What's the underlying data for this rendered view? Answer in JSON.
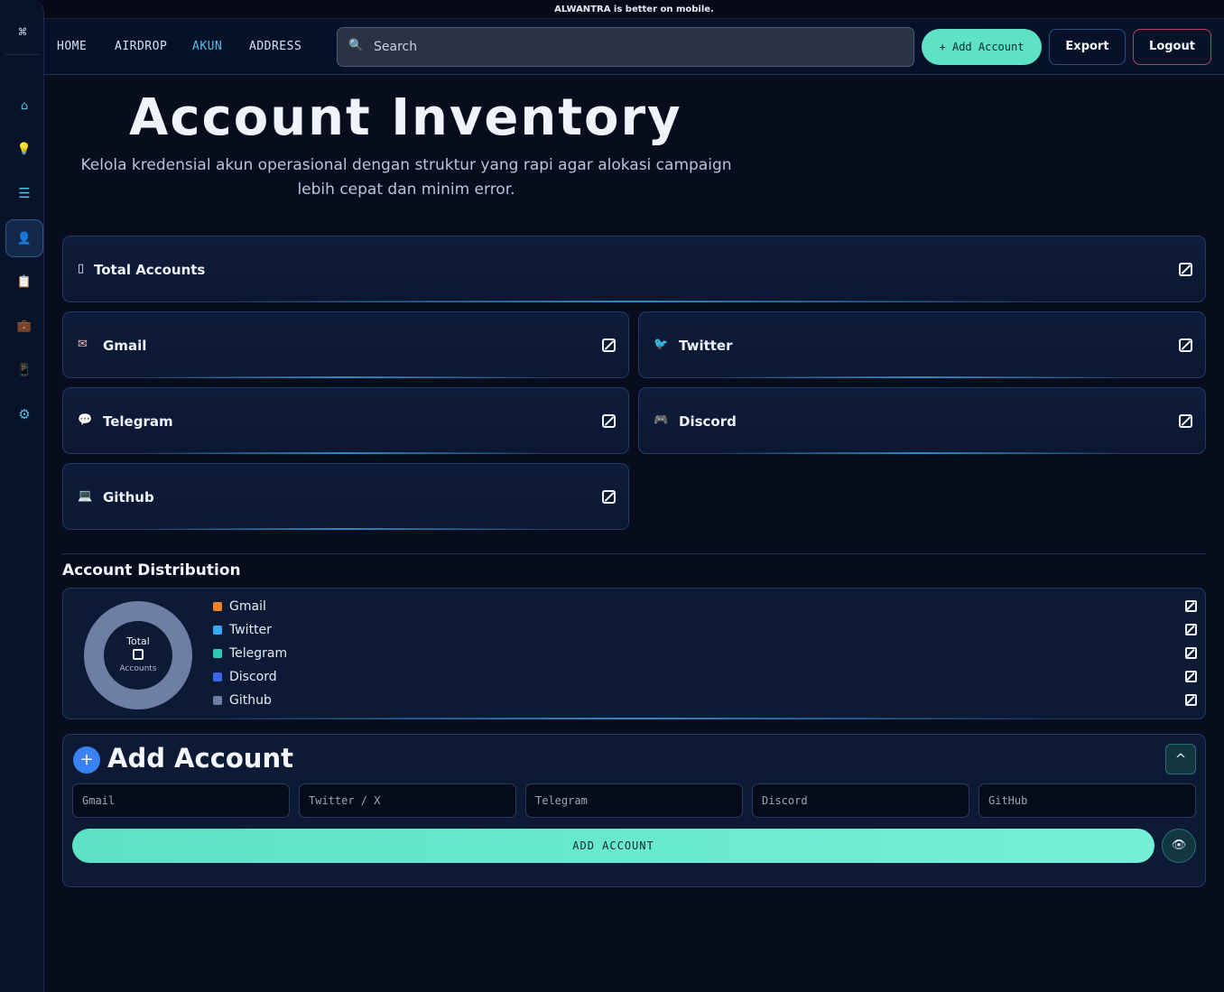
{
  "banner": "ALWANTRA is better on mobile.",
  "sidebar": {
    "logo": "⌘",
    "items": [
      {
        "icon": "home-icon",
        "glyph": "⌂",
        "color": "#4cc4e8"
      },
      {
        "icon": "lightbulb-icon",
        "glyph": "💡",
        "color": "#f5c542"
      },
      {
        "icon": "list-icon",
        "glyph": "☰",
        "color": "#4cc4e8"
      },
      {
        "icon": "user-icon",
        "glyph": "👤",
        "color": "#e6ebf5"
      },
      {
        "icon": "clipboard-icon",
        "glyph": "📋",
        "color": "#e6ebf5"
      },
      {
        "icon": "briefcase-icon",
        "glyph": "💼",
        "color": "#c98a3a"
      },
      {
        "icon": "phone-icon",
        "glyph": "📱",
        "color": "#4cc4e8"
      },
      {
        "icon": "settings-icon",
        "glyph": "⚙",
        "color": "#4cc4e8"
      }
    ]
  },
  "nav": {
    "home": "HOME",
    "airdrop": "AIRDROP",
    "akun": "AKUN",
    "address": "ADDRESS",
    "search_placeholder": "Search",
    "add_account": "+ Add Account",
    "export": "Export",
    "logout": "Logout"
  },
  "hero": {
    "title": "Account Inventory",
    "subtitle": "Kelola kredensial akun operasional dengan struktur yang rapi agar alokasi campaign lebih cepat dan minim error."
  },
  "cards": {
    "total": {
      "label": "Total Accounts",
      "icon": "▯"
    },
    "gmail": {
      "label": "Gmail",
      "icon": "✉"
    },
    "twitter": {
      "label": "Twitter",
      "icon": "🐦"
    },
    "telegram": {
      "label": "Telegram",
      "icon": "💬"
    },
    "discord": {
      "label": "Discord",
      "icon": "🎮"
    },
    "github": {
      "label": "Github",
      "icon": "💻"
    }
  },
  "distribution": {
    "title": "Account Distribution",
    "donut_top": "Total",
    "donut_bottom": "Accounts",
    "legend": [
      {
        "label": "Gmail",
        "color": "#f5822a"
      },
      {
        "label": "Twitter",
        "color": "#38a7f5"
      },
      {
        "label": "Telegram",
        "color": "#2cc9b9"
      },
      {
        "label": "Discord",
        "color": "#3a66f0"
      },
      {
        "label": "Github",
        "color": "#6d7fa3"
      }
    ]
  },
  "add_form": {
    "title": "Add Account",
    "toggle": "^",
    "placeholders": {
      "gmail": "Gmail",
      "twitter": "Twitter / X",
      "telegram": "Telegram",
      "discord": "Discord",
      "github": "GitHub"
    },
    "submit": "ADD ACCOUNT"
  }
}
